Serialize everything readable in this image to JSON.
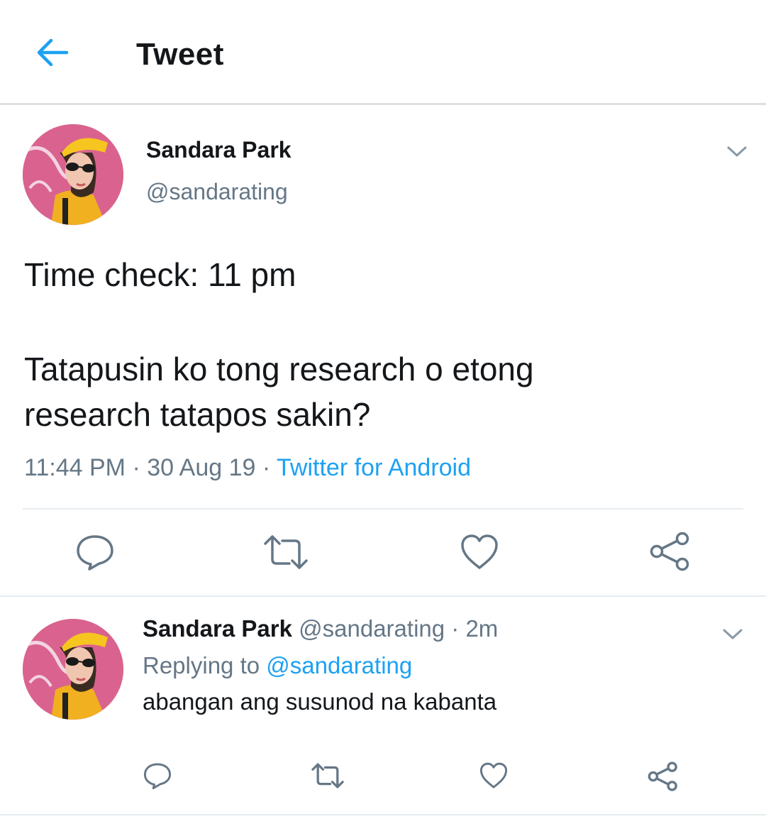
{
  "header": {
    "title": "Tweet",
    "back_icon": "arrow-left-icon",
    "accent_color": "#1da1f2"
  },
  "main_tweet": {
    "author_name": "Sandara Park",
    "author_handle": "@sandarating",
    "text_line1": "Time check: 11 pm",
    "text_line2": "Tatapusin ko tong research o etong",
    "text_line3": "research tatapos sakin?",
    "time": "11:44 PM",
    "date": "30 Aug 19",
    "source": "Twitter for Android",
    "actions": [
      "reply-icon",
      "retweet-icon",
      "like-icon",
      "share-icon"
    ]
  },
  "reply_tweet": {
    "author_name": "Sandara Park",
    "author_handle": "@sandarating",
    "age": "2m",
    "replying_prefix": "Replying to",
    "replying_to": "@sandarating",
    "text": "abangan ang susunod na kabanta",
    "actions": [
      "reply-icon",
      "retweet-icon",
      "like-icon",
      "share-icon"
    ]
  },
  "colors": {
    "text": "#14171a",
    "secondary": "#657786",
    "link": "#1da1f2",
    "divider": "#e6ecf0"
  }
}
